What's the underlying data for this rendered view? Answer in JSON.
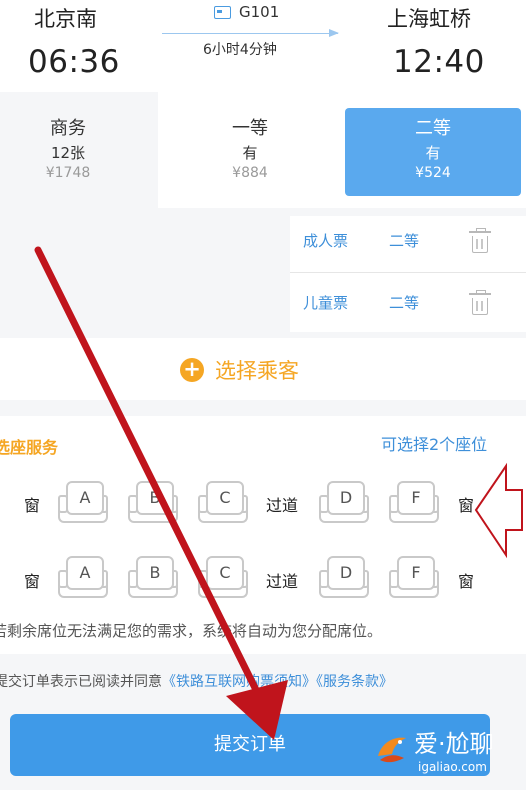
{
  "train": {
    "from_station": "北京南",
    "to_station": "上海虹桥",
    "depart_time": "06:36",
    "arrive_time": "12:40",
    "train_number": "G101",
    "duration": "6小时4分钟"
  },
  "seat_classes": [
    {
      "name": "商务",
      "availability": "12张",
      "price": "¥1748",
      "selected": false
    },
    {
      "name": "一等",
      "availability": "有",
      "price": "¥884",
      "selected": false
    },
    {
      "name": "二等",
      "availability": "有",
      "price": "¥524",
      "selected": true
    }
  ],
  "passengers": [
    {
      "type": "成人票",
      "class": "二等"
    },
    {
      "type": "儿童票",
      "class": "二等"
    }
  ],
  "choose_passenger": {
    "label": "选择乘客"
  },
  "seat_service": {
    "title": "选座服务",
    "right_text": "可选择2个座位",
    "window_label": "窗",
    "aisle_label": "过道",
    "rows": [
      {
        "left_seats": [
          "A",
          "B",
          "C"
        ],
        "right_seats": [
          "D",
          "F"
        ]
      },
      {
        "left_seats": [
          "A",
          "B",
          "C"
        ],
        "right_seats": [
          "D",
          "F"
        ]
      }
    ],
    "notice": "若剩余席位无法满足您的需求，系统将自动为您分配席位。"
  },
  "agreement": {
    "prefix": "提交订单表示已阅读并同意",
    "link1": "《铁路互联网购票须知》",
    "link2": "《服务条款》"
  },
  "submit": {
    "label": "提交订单"
  },
  "watermark": {
    "brand": "爱·尬聊",
    "url": "igaliao.com"
  },
  "colors": {
    "accent_blue": "#3f9ae8",
    "accent_orange": "#f5a623",
    "annotation_red": "#c0141c"
  }
}
